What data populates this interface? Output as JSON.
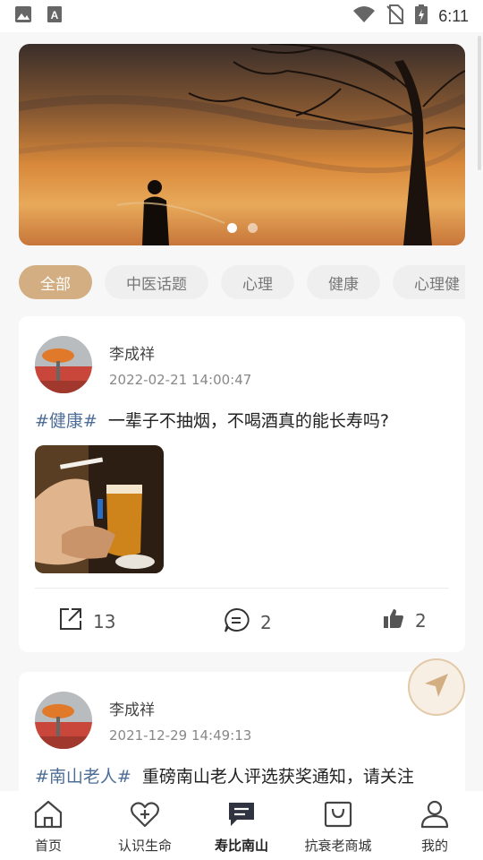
{
  "status_bar": {
    "time": "6:11",
    "left_icons": [
      "image-icon",
      "a-icon"
    ],
    "right_icons": [
      "wifi-icon",
      "no-sim-icon",
      "battery-charging-icon"
    ]
  },
  "banner": {
    "dots_count": 2,
    "active_dot": 0
  },
  "tabs": [
    {
      "label": "全部",
      "active": true
    },
    {
      "label": "中医话题",
      "active": false
    },
    {
      "label": "心理",
      "active": false
    },
    {
      "label": "健康",
      "active": false
    },
    {
      "label": "心理健",
      "active": false
    }
  ],
  "posts": [
    {
      "author": "李成祥",
      "time": "2022-02-21 14:00:47",
      "tag": "#健康#",
      "text": "一辈子不抽烟，不喝酒真的能长寿吗?",
      "share_count": "13",
      "comment_count": "2",
      "like_count": "2"
    },
    {
      "author": "李成祥",
      "time": "2021-12-29 14:49:13",
      "tag": "#南山老人#",
      "text": "重磅南山老人评选获奖通知，请关注"
    }
  ],
  "bottom_nav": [
    {
      "label": "首页",
      "icon": "home-icon",
      "active": false
    },
    {
      "label": "认识生命",
      "icon": "heart-plus-icon",
      "active": false
    },
    {
      "label": "寿比南山",
      "icon": "chat-bubble-icon",
      "active": true
    },
    {
      "label": "抗衰老商城",
      "icon": "shopping-bag-icon",
      "active": false
    },
    {
      "label": "我的",
      "icon": "user-icon",
      "active": false
    }
  ],
  "colors": {
    "accent": "#d2ae82",
    "tag": "#4e6e98",
    "nav_active": "#2f3440"
  }
}
